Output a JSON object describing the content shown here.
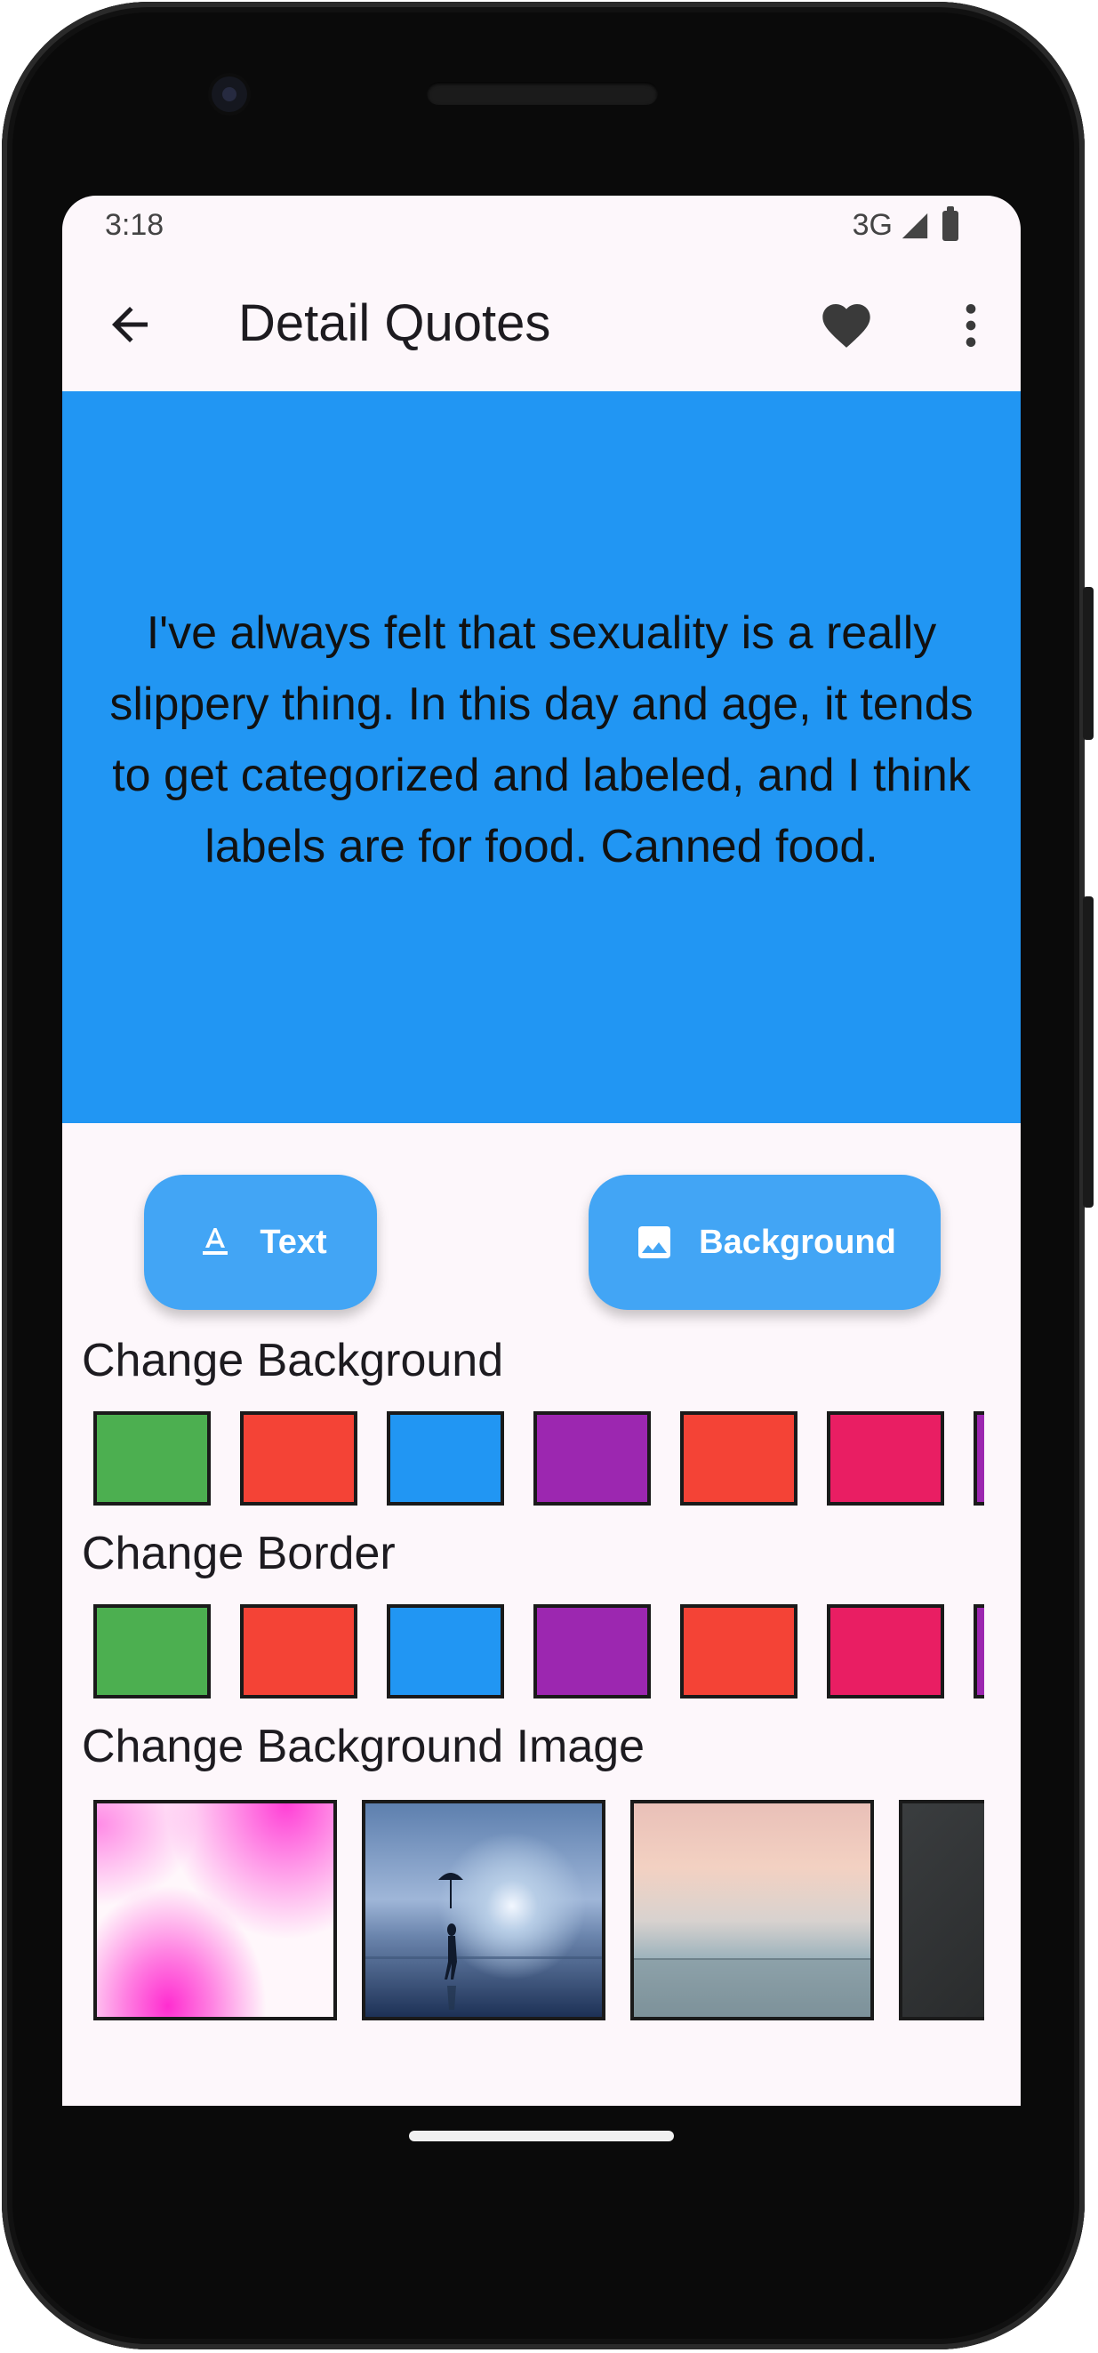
{
  "status_bar": {
    "time": "3:18",
    "network": "3G",
    "signal_icon": "cell-signal-icon",
    "battery_icon": "battery-icon"
  },
  "app_bar": {
    "title": "Detail Quotes",
    "back_icon": "arrow-back-icon",
    "favorite_icon": "heart-icon",
    "more_icon": "more-vert-icon"
  },
  "quote": {
    "text": "I've always felt that sexuality is a really slippery thing. In this day and age, it tends to get categorized and labeled, and I think labels are for food. Canned food.",
    "background_color": "#2196f3"
  },
  "actions": {
    "text_button": {
      "label": "Text",
      "icon": "text-format-icon"
    },
    "background_button": {
      "label": "Background",
      "icon": "image-icon"
    },
    "accent_color": "#42a5f5"
  },
  "sections": {
    "change_background": {
      "title": "Change Background",
      "colors": [
        "#4caf50",
        "#f44336",
        "#2196f3",
        "#9c27b0",
        "#f44336",
        "#e91e63",
        "#9c27b0"
      ]
    },
    "change_border": {
      "title": "Change Border",
      "colors": [
        "#4caf50",
        "#f44336",
        "#2196f3",
        "#9c27b0",
        "#f44336",
        "#e91e63",
        "#9c27b0"
      ]
    },
    "change_background_image": {
      "title": "Change Background Image",
      "images": [
        "pink-watercolor-image",
        "ocean-umbrella-image",
        "sunset-sea-image",
        "dark-texture-image"
      ]
    }
  }
}
